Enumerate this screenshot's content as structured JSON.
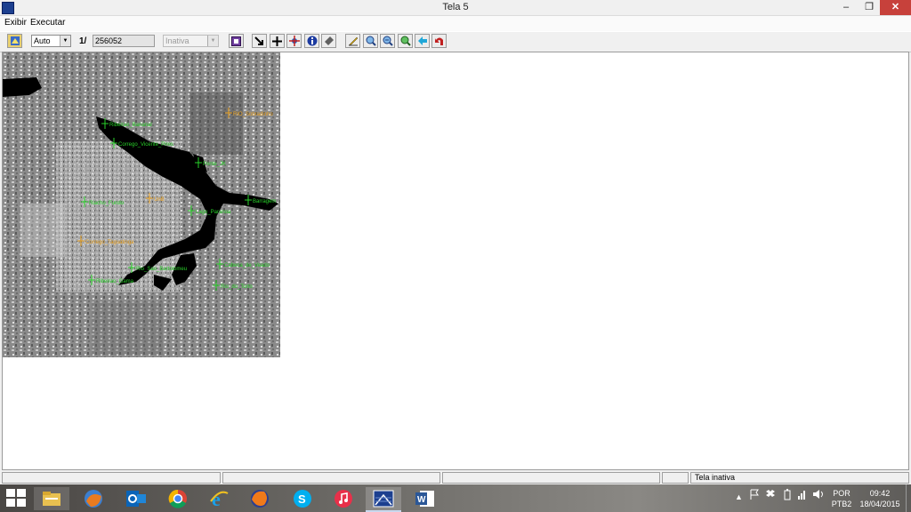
{
  "window": {
    "title": "Tela 5",
    "minimize": "‒",
    "maximize": "❐",
    "close": "✕"
  },
  "menu": {
    "items": [
      "Exibir",
      "Executar"
    ]
  },
  "toolbar": {
    "zoom_mode": "Auto",
    "scale_prefix": "1/",
    "scale_value": "256052",
    "layer_state": "Inativa"
  },
  "map": {
    "labels": [
      {
        "text": "RIO_Sobradinho",
        "color": "#e8a020"
      },
      {
        "text": "Ribeirao_Bananal",
        "color": "#29d12a"
      },
      {
        "text": "Corrego_Vicente_Pires",
        "color": "#29d12a"
      },
      {
        "text": "Ponte_JK",
        "color": "#29d12a"
      },
      {
        "text": "Barragem",
        "color": "#29d12a"
      },
      {
        "text": "Riacho_Fundo",
        "color": "#29d12a"
      },
      {
        "text": "UnB",
        "color": "#e8a020"
      },
      {
        "text": "Lago_Paranoa",
        "color": "#29d12a"
      },
      {
        "text": "Corrego_Taguatinga",
        "color": "#e8a020"
      },
      {
        "text": "Rio_Sao_Bartolomeu",
        "color": "#29d12a"
      },
      {
        "text": "Cabeca_de_Veado",
        "color": "#29d12a"
      },
      {
        "text": "Ribeirao_Gama",
        "color": "#29d12a"
      },
      {
        "text": "Rio_do_Torto",
        "color": "#29d12a"
      }
    ]
  },
  "status": {
    "panels": [
      "",
      "",
      "",
      "",
      "Tela inativa"
    ]
  },
  "taskbar": {
    "apps": [
      "file-explorer-icon",
      "firefox-old-icon",
      "outlook-icon",
      "chrome-icon",
      "ie-icon",
      "firefox-icon",
      "skype-icon",
      "itunes-icon",
      "spring-icon",
      "word-icon"
    ],
    "language_top": "POR",
    "language_bottom": "PTB2",
    "time": "09:42",
    "date": "18/04/2015"
  }
}
